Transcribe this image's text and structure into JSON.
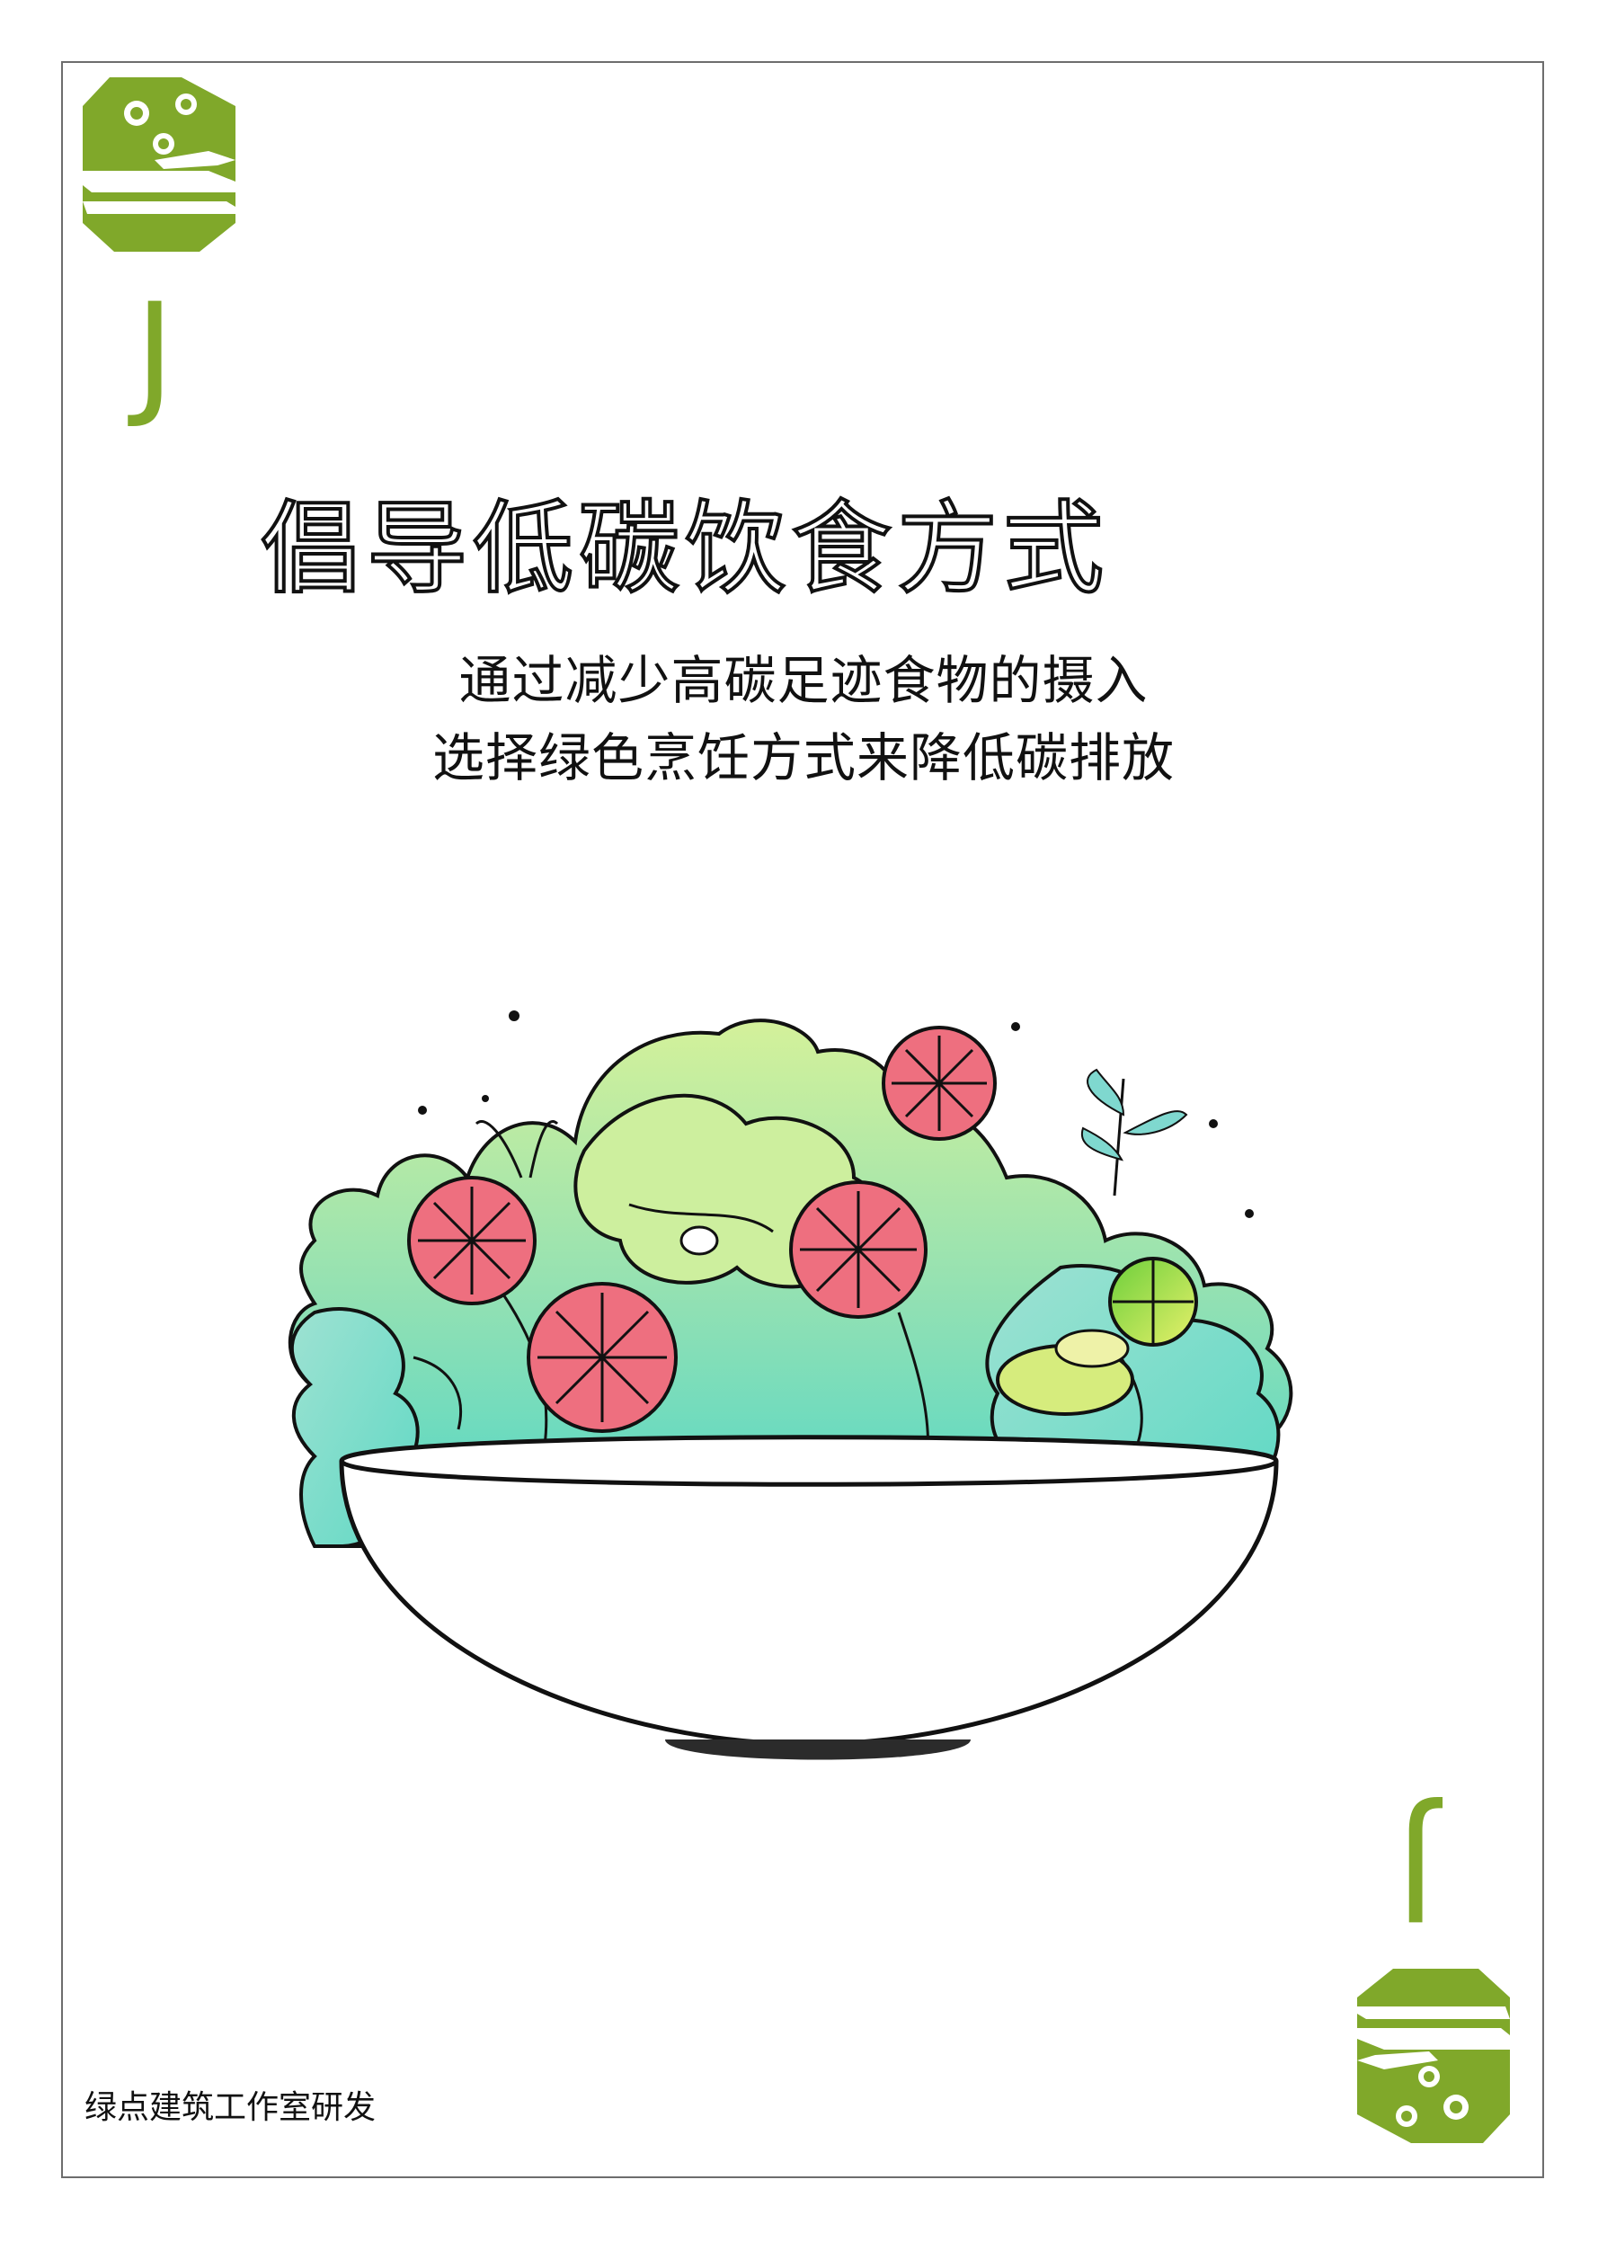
{
  "card": {
    "letter_top": "J",
    "letter_bottom": "J",
    "title": "倡导低碳饮食方式",
    "subtitle_line1": "通过减少高碳足迹食物的摄入",
    "subtitle_line2": "选择绿色烹饪方式来降低碳排放",
    "footer": "绿点建筑工作室研发",
    "icon_top": "green-drum-mascot-icon",
    "icon_bottom": "green-drum-mascot-icon",
    "illustration": "salad-bowl-illustration"
  },
  "colors": {
    "accent": "#80a82a",
    "text": "#111111",
    "border": "#6d6d6d",
    "tomato": "#ee6f7f",
    "lettuce_light": "#c8ee9c",
    "lettuce_teal": "#7fd8cf"
  }
}
